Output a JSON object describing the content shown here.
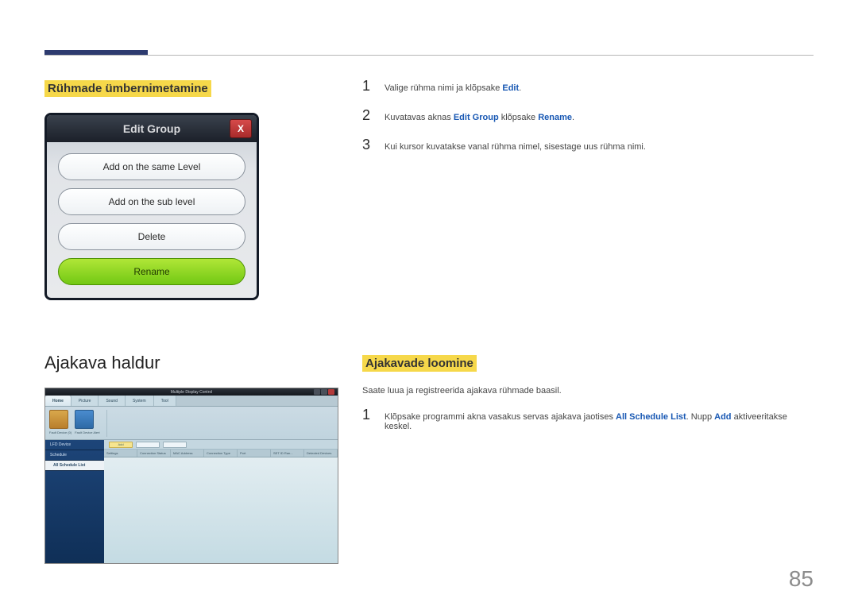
{
  "headings": {
    "rename_groups": "Rühmade ümbernimetamine",
    "schedule_manager": "Ajakava haldur",
    "creating_schedules": "Ajakavade loomine"
  },
  "edit_group": {
    "title": "Edit Group",
    "close": "X",
    "btn_same_level": "Add on the same Level",
    "btn_sub_level": "Add on the sub level",
    "btn_delete": "Delete",
    "btn_rename": "Rename"
  },
  "steps_a": {
    "n1": "1",
    "t1a": "Valige rühma nimi ja klõpsake ",
    "t1b": "Edit",
    "t1c": ".",
    "n2": "2",
    "t2a": "Kuvatavas aknas ",
    "t2b": "Edit Group",
    "t2c": " klõpsake ",
    "t2d": "Rename",
    "t2e": ".",
    "n3": "3",
    "t3": "Kui kursor kuvatakse vanal rühma nimel, sisestage uus rühma nimi."
  },
  "app": {
    "title": "Multiple Display Control",
    "tabs": {
      "home": "Home",
      "picture": "Picture",
      "sound": "Sound",
      "system": "System",
      "tool": "Tool"
    },
    "ribbon": {
      "fault_device": "Fault Device (0)",
      "fault_alert": "Fault Device Alert"
    },
    "sidebar": {
      "lfd": "LFD Device",
      "schedule": "Schedule",
      "all_schedule": "All Schedule List"
    },
    "toolbar": {
      "add": "Add"
    },
    "columns": {
      "c1": "Settings",
      "c2": "Connection Status",
      "c3": "MAC Address",
      "c4": "Connection Type",
      "c5": "Port",
      "c6": "SET ID Ran...",
      "c7": "Detected Devices"
    }
  },
  "schedule_desc": "Saate luua ja registreerida ajakava rühmade baasil.",
  "steps_b": {
    "n1": "1",
    "t1a": "Klõpsake programmi akna vasakus servas ajakava jaotises ",
    "t1b": "All Schedule List",
    "t1c": ". Nupp ",
    "t1d": "Add",
    "t1e": " aktiveeritakse keskel."
  },
  "page_number": "85"
}
